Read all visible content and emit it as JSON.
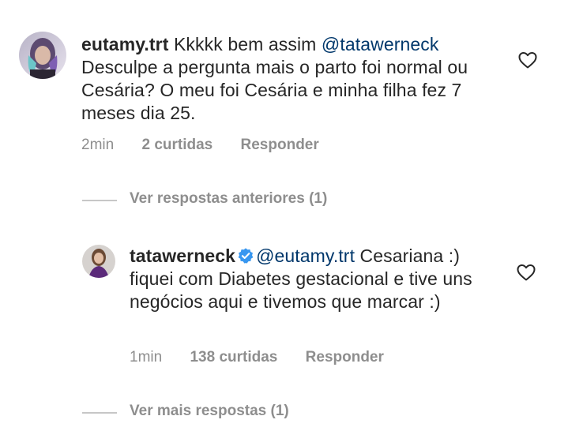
{
  "comment1": {
    "username": "eutamy.trt",
    "text_before_mention": " Kkkkk bem assim ",
    "mention": "@tatawerneck",
    "text_after": " Desculpe a pergunta mais o parto foi normal ou Cesária? O meu foi Cesária e minha filha fez 7 meses dia 25.",
    "time": "2min",
    "likes": "2 curtidas",
    "reply_label": "Responder"
  },
  "view_previous": {
    "label": "Ver respostas anteriores (1)"
  },
  "reply1": {
    "username": "tatawerneck",
    "verified": true,
    "mention": "@eutamy.trt",
    "text_after": " Cesariana :) fiquei com Diabetes gestacional e tive uns negócios aqui e tivemos que marcar :)",
    "time": "1min",
    "likes": "138 curtidas",
    "reply_label": "Responder"
  },
  "view_more": {
    "label": "Ver mais respostas (1)"
  },
  "colors": {
    "text": "#262626",
    "secondary": "#8e8e8e",
    "mention": "#00376b",
    "verified": "#3897f0",
    "line": "#c7c7c7"
  },
  "icons": {
    "like": "heart-outline-icon",
    "verified": "verified-badge-icon"
  }
}
